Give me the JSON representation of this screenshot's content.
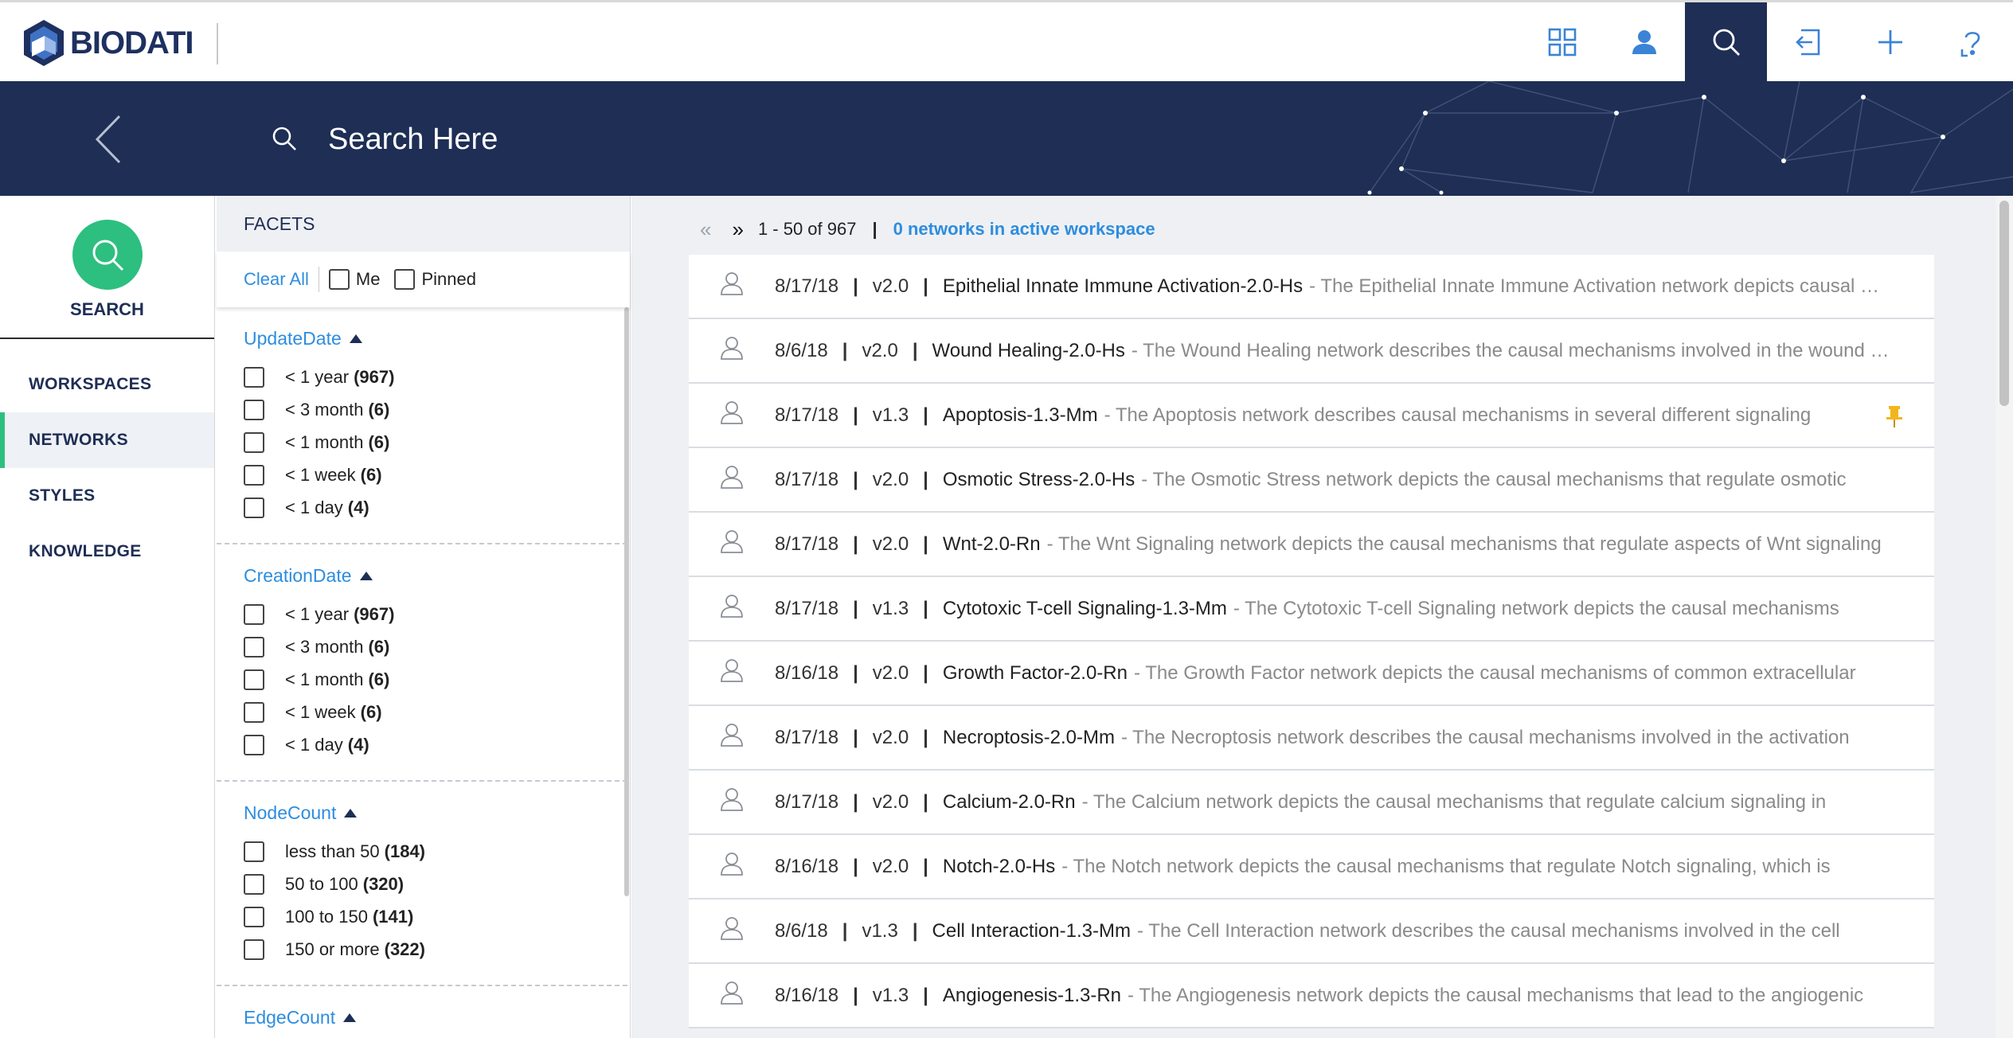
{
  "header": {
    "logo_text": "BIODATI",
    "icons": [
      "grid-icon",
      "user-icon",
      "search-icon",
      "import-icon",
      "plus-icon",
      "help-icon"
    ],
    "active_icon": "search-icon"
  },
  "banner": {
    "search_placeholder": "Search Here"
  },
  "leftnav": {
    "search_label": "SEARCH",
    "items": [
      {
        "label": "WORKSPACES",
        "active": false
      },
      {
        "label": "NETWORKS",
        "active": true
      },
      {
        "label": "STYLES",
        "active": false
      },
      {
        "label": "KNOWLEDGE",
        "active": false
      }
    ]
  },
  "facets": {
    "title": "FACETS",
    "clear_all": "Clear All",
    "me_label": "Me",
    "pinned_label": "Pinned",
    "groups": [
      {
        "title": "UpdateDate",
        "options": [
          {
            "label": "< 1 year",
            "count": "(967)"
          },
          {
            "label": "< 3 month",
            "count": "(6)"
          },
          {
            "label": "< 1 month",
            "count": "(6)"
          },
          {
            "label": "< 1 week",
            "count": "(6)"
          },
          {
            "label": "< 1 day",
            "count": "(4)"
          }
        ]
      },
      {
        "title": "CreationDate",
        "options": [
          {
            "label": "< 1 year",
            "count": "(967)"
          },
          {
            "label": "< 3 month",
            "count": "(6)"
          },
          {
            "label": "< 1 month",
            "count": "(6)"
          },
          {
            "label": "< 1 week",
            "count": "(6)"
          },
          {
            "label": "< 1 day",
            "count": "(4)"
          }
        ]
      },
      {
        "title": "NodeCount",
        "options": [
          {
            "label": "less than 50",
            "count": "(184)"
          },
          {
            "label": "50 to 100",
            "count": "(320)"
          },
          {
            "label": "100 to 150",
            "count": "(141)"
          },
          {
            "label": "150 or more",
            "count": "(322)"
          }
        ]
      },
      {
        "title": "EdgeCount",
        "options": []
      }
    ]
  },
  "pager": {
    "prev": "«",
    "next": "»",
    "range": "1 - 50 of 967",
    "workspace_text": "0 networks in active workspace"
  },
  "results": [
    {
      "date": "8/17/18",
      "version": "v2.0",
      "title": "Epithelial Innate Immune Activation-2.0-Hs",
      "desc": "- The Epithelial Innate Immune Activation network depicts causal mechanisms",
      "pinned": false
    },
    {
      "date": "8/6/18",
      "version": "v2.0",
      "title": "Wound Healing-2.0-Hs",
      "desc": "- The Wound Healing network describes the causal mechanisms involved in the wound healing",
      "pinned": false
    },
    {
      "date": "8/17/18",
      "version": "v1.3",
      "title": "Apoptosis-1.3-Mm",
      "desc": "- The Apoptosis network describes causal mechanisms in several different signaling",
      "pinned": true
    },
    {
      "date": "8/17/18",
      "version": "v2.0",
      "title": "Osmotic Stress-2.0-Hs",
      "desc": "- The Osmotic Stress network depicts the causal mechanisms that regulate osmotic",
      "pinned": false
    },
    {
      "date": "8/17/18",
      "version": "v2.0",
      "title": "Wnt-2.0-Rn",
      "desc": "- The Wnt Signaling network depicts the causal mechanisms that regulate aspects of Wnt signaling",
      "pinned": false
    },
    {
      "date": "8/17/18",
      "version": "v1.3",
      "title": "Cytotoxic T-cell Signaling-1.3-Mm",
      "desc": "- The Cytotoxic T-cell Signaling network depicts the causal mechanisms",
      "pinned": false
    },
    {
      "date": "8/16/18",
      "version": "v2.0",
      "title": "Growth Factor-2.0-Rn",
      "desc": "- The Growth Factor network depicts the causal mechanisms of common extracellular",
      "pinned": false
    },
    {
      "date": "8/17/18",
      "version": "v2.0",
      "title": "Necroptosis-2.0-Mm",
      "desc": "- The Necroptosis network describes the causal mechanisms involved in the activation",
      "pinned": false
    },
    {
      "date": "8/17/18",
      "version": "v2.0",
      "title": "Calcium-2.0-Rn",
      "desc": "- The Calcium network depicts the causal mechanisms that regulate calcium signaling in",
      "pinned": false
    },
    {
      "date": "8/16/18",
      "version": "v2.0",
      "title": "Notch-2.0-Hs",
      "desc": "- The Notch network depicts the causal mechanisms that regulate Notch signaling, which is",
      "pinned": false
    },
    {
      "date": "8/6/18",
      "version": "v1.3",
      "title": "Cell Interaction-1.3-Mm",
      "desc": "- The Cell Interaction network describes the causal mechanisms involved in the cell",
      "pinned": false
    },
    {
      "date": "8/16/18",
      "version": "v1.3",
      "title": "Angiogenesis-1.3-Rn",
      "desc": "- The Angiogenesis network depicts the causal mechanisms that lead to the angiogenic",
      "pinned": false
    }
  ],
  "colors": {
    "navy": "#1e2e55",
    "accent_green": "#2dbf7f",
    "link_blue": "#2d8ddf",
    "pin_yellow": "#f2b61b"
  }
}
